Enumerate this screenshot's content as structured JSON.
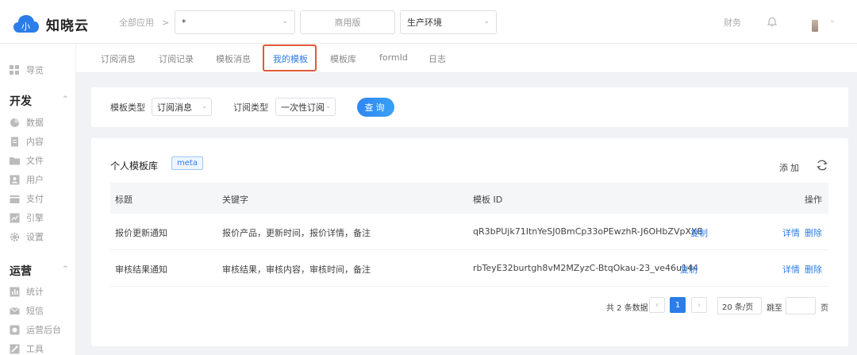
{
  "header": {
    "logo_text": "知晓云",
    "breadcrumb": "全部应用",
    "breadcrumb_sep": ">",
    "app_select_value": "*",
    "edition": "商用版",
    "env_select_value": "生产环境",
    "finance": "财务"
  },
  "sidebar": {
    "overview": "导览",
    "group_dev": "开发",
    "dev_items": [
      "数据",
      "内容",
      "文件",
      "用户",
      "支付",
      "引擎",
      "设置"
    ],
    "group_ops": "运营",
    "ops_items": [
      "统计",
      "短信",
      "运营后台",
      "工具"
    ]
  },
  "tabs": [
    "订阅消息",
    "订阅记录",
    "模板消息",
    "我的模板",
    "模板库",
    "formId",
    "日志"
  ],
  "filter": {
    "template_type_label": "模板类型",
    "template_type_value": "订阅消息",
    "sub_type_label": "订阅类型",
    "sub_type_value": "一次性订阅",
    "query_label": "查询"
  },
  "card": {
    "title": "个人模板库",
    "tag": "meta",
    "add_label": "添加",
    "columns": [
      "标题",
      "关键字",
      "模板 ID",
      "操作"
    ],
    "rows": [
      {
        "title": "报价更新通知",
        "keywords": "报价产品，更新时间，报价详情，备注",
        "template_id": "qR3bPUjk71ItnYeSJ0BmCp33oPEwzhR-J6OHbZVpXXE",
        "copy": "复制",
        "detail": "详情",
        "delete": "删除"
      },
      {
        "title": "审核结果通知",
        "keywords": "审核结果，审核内容，审核时间，备注",
        "template_id": "rbTeyE32burtgh8vM2MZyzC-BtqOkau-23_ve46u144",
        "copy": "复制",
        "detail": "详情",
        "delete": "删除"
      }
    ]
  },
  "pagination": {
    "total_text": "共 2 条数据",
    "current_page": "1",
    "page_size": "20 条/页",
    "jump_label": "跳至",
    "page_unit": "页"
  },
  "colors": {
    "accent": "#2b7de9",
    "highlight_border": "#e05a3a"
  }
}
